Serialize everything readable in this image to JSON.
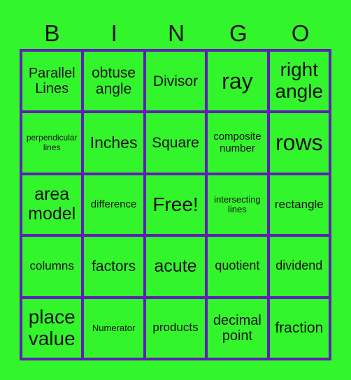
{
  "header": {
    "letters": [
      "B",
      "I",
      "N",
      "G",
      "O"
    ]
  },
  "colors": {
    "background": "#33f52b",
    "border": "#5f1fb5",
    "text": "#111111"
  },
  "cells": [
    [
      "Parallel Lines",
      "obtuse angle",
      "Divisor",
      "ray",
      "right angle"
    ],
    [
      "perpendicular lines",
      "Inches",
      "Square",
      "composite number",
      "rows"
    ],
    [
      "area model",
      "difference",
      "Free!",
      "intersecting lines",
      "rectangle"
    ],
    [
      "columns",
      "factors",
      "acute",
      "quotient",
      "dividend"
    ],
    [
      "place value",
      "Numerator",
      "products",
      "decimal point",
      "fraction"
    ]
  ]
}
